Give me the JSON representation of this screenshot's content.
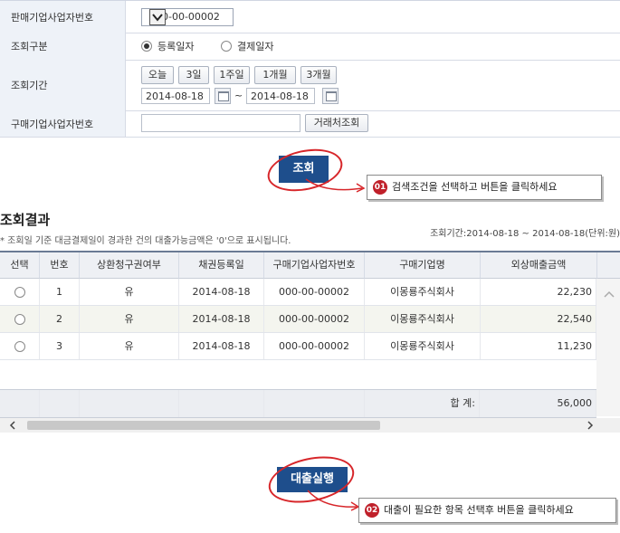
{
  "form": {
    "seller_label": "판매기업사업자번호",
    "seller_value": "000-00-00002",
    "query_type_label": "조회구분",
    "query_type_options": [
      "등록일자",
      "결제일자"
    ],
    "query_type_selected": "등록일자",
    "period_label": "조회기간",
    "period_buttons": [
      "오늘",
      "3일",
      "1주일",
      "1개월",
      "3개월"
    ],
    "date_from": "2014-08-18",
    "date_sep": "~",
    "date_to": "2014-08-18",
    "buyer_label": "구매기업사업자번호",
    "buyer_value": "",
    "buyer_search_button": "거래처조회"
  },
  "search_button": "조회",
  "callout1": {
    "num": "01",
    "text": "검색조건을 선택하고 버튼을 클릭하세요"
  },
  "results": {
    "title": "조회결과",
    "note": "* 조회일 기준 대금결제일이 경과한 건의 대출가능금액은 '0'으로 표시됩니다.",
    "period_info": "조회기간:2014-08-18 ~ 2014-08-18(단위:원)",
    "columns": [
      "선택",
      "번호",
      "상환청구권여부",
      "채권등록일",
      "구매기업사업자번호",
      "구매기업명",
      "외상매출금액"
    ],
    "rows": [
      {
        "no": "1",
        "recourse": "유",
        "reg_date": "2014-08-18",
        "buyer_no": "000-00-00002",
        "buyer_name": "이몽룡주식회사",
        "amount": "22,230"
      },
      {
        "no": "2",
        "recourse": "유",
        "reg_date": "2014-08-18",
        "buyer_no": "000-00-00002",
        "buyer_name": "이몽룡주식회사",
        "amount": "22,540"
      },
      {
        "no": "3",
        "recourse": "유",
        "reg_date": "2014-08-18",
        "buyer_no": "000-00-00002",
        "buyer_name": "이몽룡주식회사",
        "amount": "11,230"
      }
    ],
    "total_label": "합 계:",
    "total_value": "56,000"
  },
  "loan_button": "대출실행",
  "callout2": {
    "num": "02",
    "text": "대출이 필요한 항목 선택후 버튼을 클릭하세요"
  },
  "colors": {
    "accent": "#1e4e8c",
    "callout_red": "#d7262a",
    "label_bg": "#eef2f8"
  },
  "icons": [
    "chevron-down-icon",
    "calendar-icon",
    "chevron-left-icon",
    "chevron-right-icon",
    "chevron-up-icon"
  ]
}
